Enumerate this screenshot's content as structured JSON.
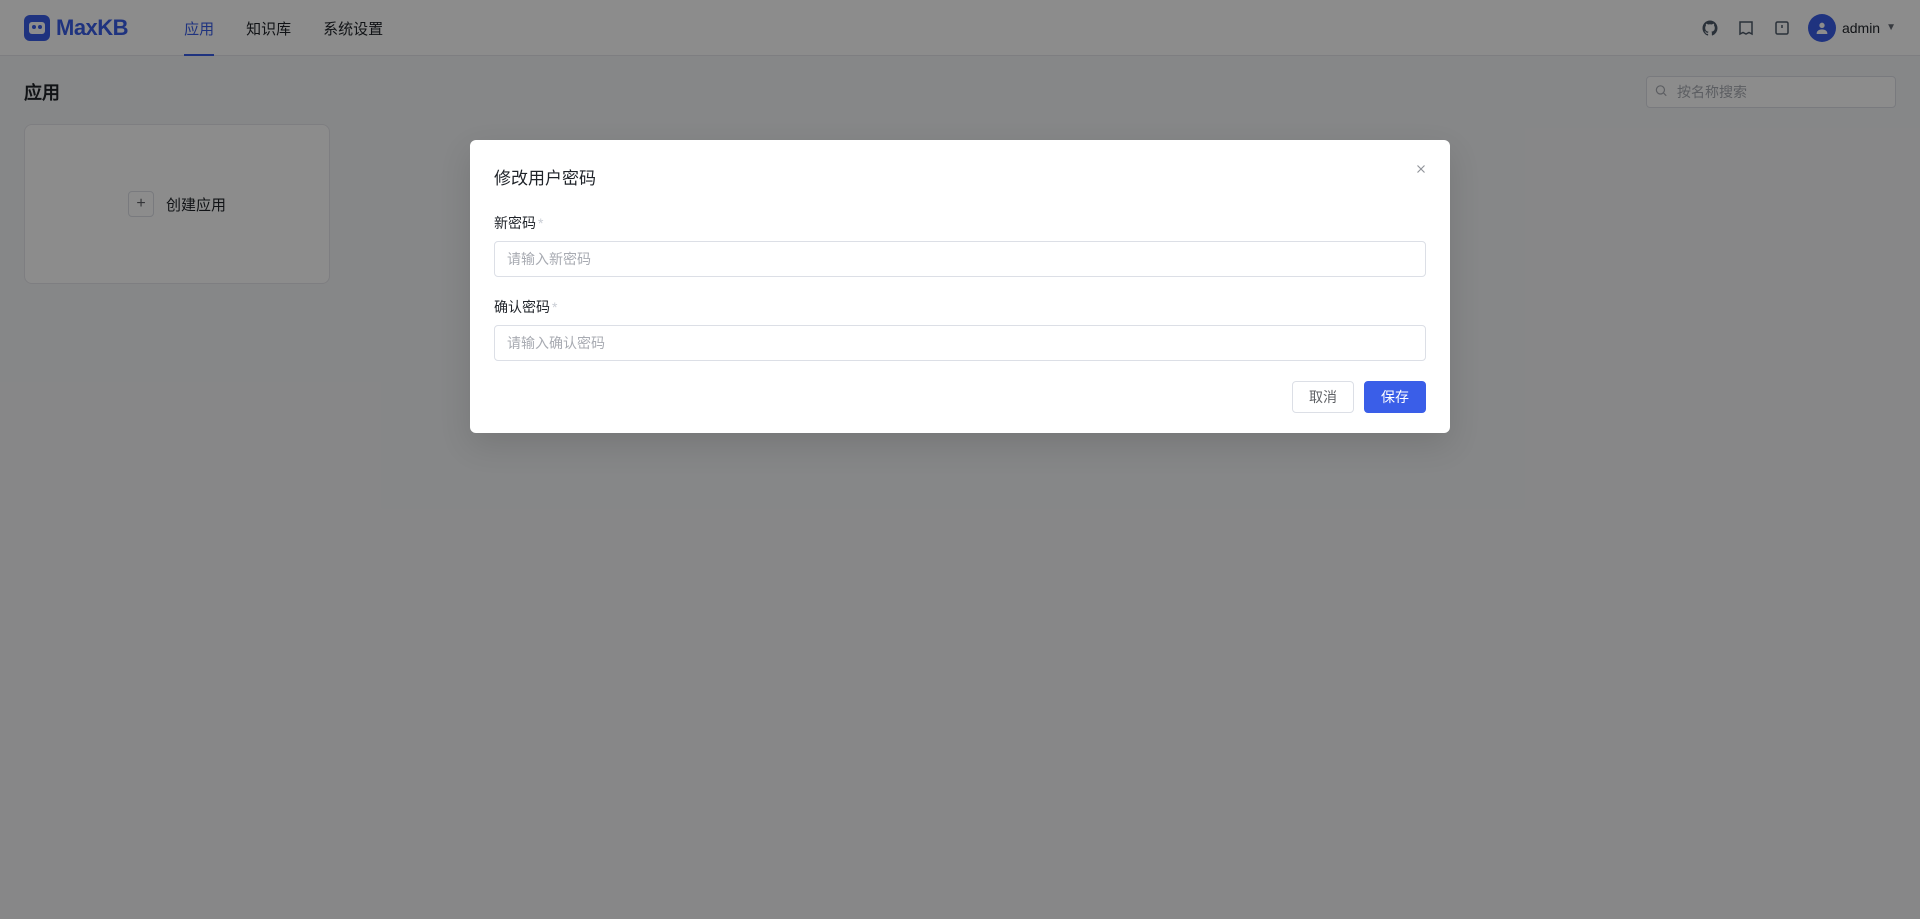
{
  "header": {
    "logo_text": "MaxKB",
    "nav": [
      {
        "label": "应用",
        "active": true
      },
      {
        "label": "知识库",
        "active": false
      },
      {
        "label": "系统设置",
        "active": false
      }
    ],
    "user_name": "admin"
  },
  "page": {
    "title": "应用",
    "search_placeholder": "按名称搜索",
    "create_card_label": "创建应用"
  },
  "dialog": {
    "title": "修改用户密码",
    "fields": {
      "new_password": {
        "label": "新密码",
        "placeholder": "请输入新密码",
        "required": true
      },
      "confirm_password": {
        "label": "确认密码",
        "placeholder": "请输入确认密码",
        "required": true
      }
    },
    "buttons": {
      "cancel": "取消",
      "save": "保存"
    }
  },
  "colors": {
    "primary": "#3a5ee8"
  }
}
